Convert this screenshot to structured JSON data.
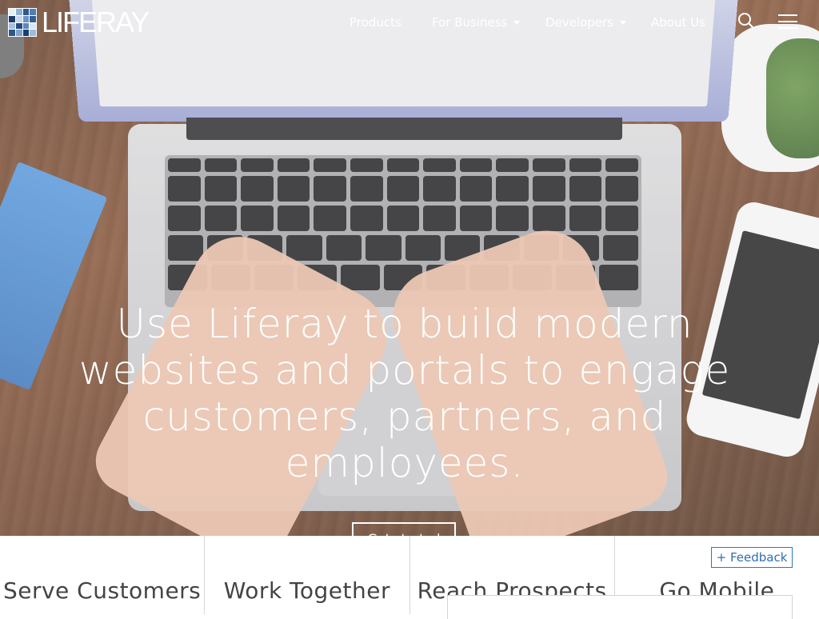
{
  "brand": {
    "name": "LIFERAY",
    "logo_colors": [
      "#e6eef6",
      "#8fb0d6",
      "#2a5a8f",
      "#4f7fb6",
      "#1d3e6a",
      "#c7d6ea",
      "#6b93c4",
      "#335f95",
      "#a6c0df",
      "#234b7b",
      "#5c87bc",
      "#dbe6f2",
      "#2f5688",
      "#7ea1cf",
      "#184070",
      "#9fbbdc"
    ]
  },
  "nav": {
    "items": [
      {
        "label": "Products",
        "dropdown": false
      },
      {
        "label": "For Business",
        "dropdown": true
      },
      {
        "label": "Developers",
        "dropdown": true
      },
      {
        "label": "About Us",
        "dropdown": false
      }
    ],
    "search_icon": "search-icon",
    "menu_icon": "hamburger-menu-icon"
  },
  "hero": {
    "headline": "Use Liferay to build modern websites and portals to engage customers, partners, and employees.",
    "cta_label": "Get started"
  },
  "bottom_nav": {
    "items": [
      {
        "label": "Serve Customers"
      },
      {
        "label": "Work Together"
      },
      {
        "label": "Reach Prospects"
      },
      {
        "label": "Go Mobile"
      }
    ]
  },
  "feedback": {
    "label": "+ Feedback"
  },
  "colors": {
    "accent": "#2e7bb6",
    "text_dark": "#444444",
    "hero_text": "#ffffff"
  }
}
